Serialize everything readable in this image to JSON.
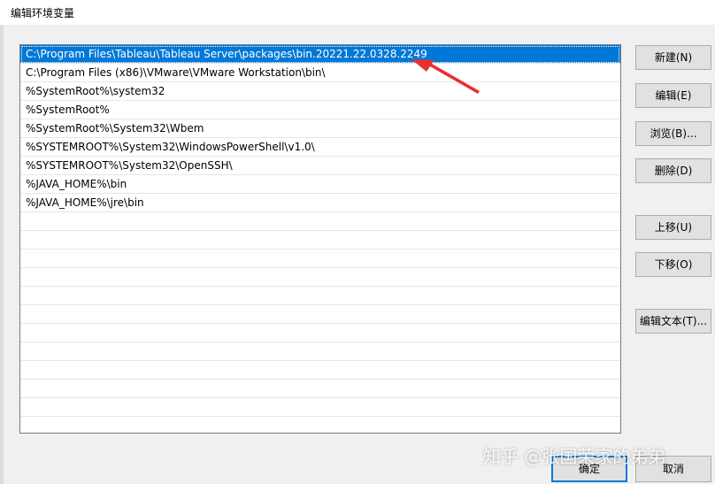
{
  "window": {
    "title": "编辑环境变量"
  },
  "paths": [
    "C:\\Program Files\\Tableau\\Tableau Server\\packages\\bin.20221.22.0328.2249",
    "C:\\Program Files (x86)\\VMware\\VMware Workstation\\bin\\",
    "%SystemRoot%\\system32",
    "%SystemRoot%",
    "%SystemRoot%\\System32\\Wbem",
    "%SYSTEMROOT%\\System32\\WindowsPowerShell\\v1.0\\",
    "%SYSTEMROOT%\\System32\\OpenSSH\\",
    "%JAVA_HOME%\\bin",
    "%JAVA_HOME%\\jre\\bin"
  ],
  "selected_index": 0,
  "buttons": {
    "new": "新建(N)",
    "edit": "编辑(E)",
    "browse": "浏览(B)...",
    "delete": "删除(D)",
    "move_up": "上移(U)",
    "move_down": "下移(O)",
    "edit_text": "编辑文本(T)...",
    "ok": "确定",
    "cancel": "取消"
  },
  "watermark": "知乎 @张国荣家的弟弟",
  "colors": {
    "selection": "#0078d7",
    "arrow": "#e8312f"
  }
}
